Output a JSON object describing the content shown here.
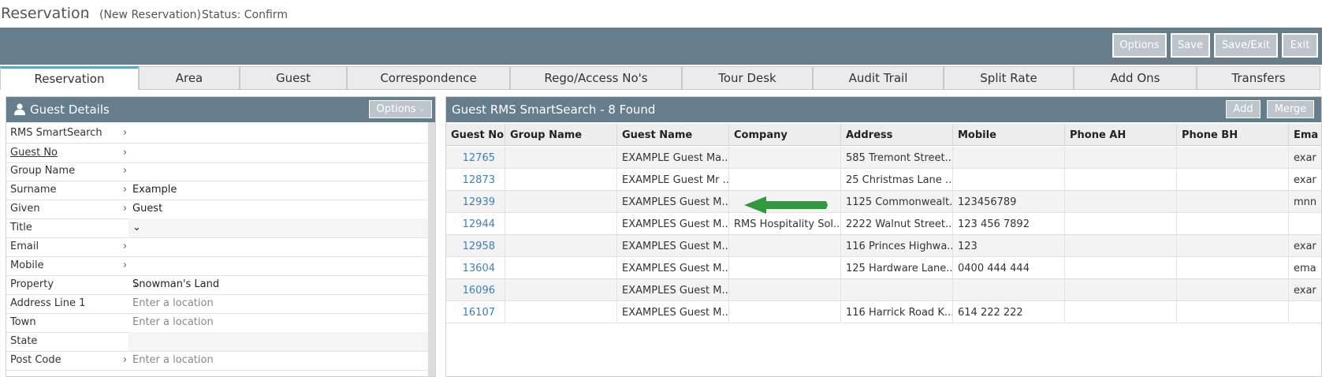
{
  "header": {
    "title": "Reservation",
    "dash": "-",
    "subtitle": "(New Reservation)",
    "status": "Status: Confirm"
  },
  "toolbar": {
    "options": "Options",
    "save": "Save",
    "save_exit": "Save/Exit",
    "exit": "Exit"
  },
  "tabs": [
    "Reservation",
    "Area",
    "Guest",
    "Correspondence",
    "Rego/Access No's",
    "Tour Desk",
    "Audit Trail",
    "Split Rate",
    "Add Ons",
    "Transfers"
  ],
  "guest_details": {
    "title": "Guest Details",
    "options_label": "Options",
    "fields": [
      {
        "label": "RMS SmartSearch",
        "value": "",
        "placeholder": ""
      },
      {
        "label": "Guest No",
        "value": "",
        "placeholder": ""
      },
      {
        "label": "Group Name",
        "value": "",
        "placeholder": ""
      },
      {
        "label": "Surname",
        "value": "Example",
        "placeholder": ""
      },
      {
        "label": "Given",
        "value": "Guest",
        "placeholder": ""
      },
      {
        "label": "Title",
        "value": "",
        "placeholder": ""
      },
      {
        "label": "Email",
        "value": "",
        "placeholder": ""
      },
      {
        "label": "Mobile",
        "value": "",
        "placeholder": ""
      },
      {
        "label": "Property",
        "value": "Snowman's Land",
        "placeholder": ""
      },
      {
        "label": "Address Line 1",
        "value": "",
        "placeholder": "Enter a location"
      },
      {
        "label": "Town",
        "value": "",
        "placeholder": "Enter a location"
      },
      {
        "label": "State",
        "value": "",
        "placeholder": ""
      },
      {
        "label": "Post Code",
        "value": "",
        "placeholder": "Enter a location"
      }
    ]
  },
  "search": {
    "title": "Guest RMS SmartSearch - 8 Found",
    "add": "Add",
    "merge": "Merge",
    "columns": [
      "Guest No",
      "Group Name",
      "Guest Name",
      "Company",
      "Address",
      "Mobile",
      "Phone AH",
      "Phone BH",
      "Ema"
    ],
    "rows": [
      [
        "12765",
        "",
        "EXAMPLE Guest Ma...",
        "",
        "585 Tremont Street...",
        "",
        "",
        "",
        "exar"
      ],
      [
        "12873",
        "",
        "EXAMPLE Guest Mr ...",
        "",
        "25 Christmas Lane ...",
        "",
        "",
        "",
        "exar"
      ],
      [
        "12939",
        "",
        "EXAMPLES Guest M...",
        "",
        "1125 Commonwealt...",
        "123456789",
        "",
        "",
        "mnn"
      ],
      [
        "12944",
        "",
        "EXAMPLES Guest M...",
        "RMS Hospitality Sol...",
        "2222 Walnut Street...",
        "123 456 7892",
        "",
        "",
        ""
      ],
      [
        "12958",
        "",
        "EXAMPLES Guest M...",
        "",
        "116 Princes Highwa...",
        "123",
        "",
        "",
        "exar"
      ],
      [
        "13604",
        "",
        "EXAMPLES Guest M...",
        "",
        "125 Hardware Lane...",
        "0400 444 444",
        "",
        "",
        "ema"
      ],
      [
        "16096",
        "",
        "EXAMPLES Guest M...",
        "",
        "",
        "",
        "",
        "",
        "exar"
      ],
      [
        "16107",
        "",
        "EXAMPLES Guest M...",
        "",
        "116 Harrick Road K...",
        "614 222 222",
        "",
        "",
        ""
      ]
    ]
  },
  "colors": {
    "toolbar": "#667d8b",
    "button": "#bcc5cb",
    "link": "#3a7fbf",
    "tab_active_accent": "#5aa5c9",
    "arrow": "#2e9a3c"
  }
}
